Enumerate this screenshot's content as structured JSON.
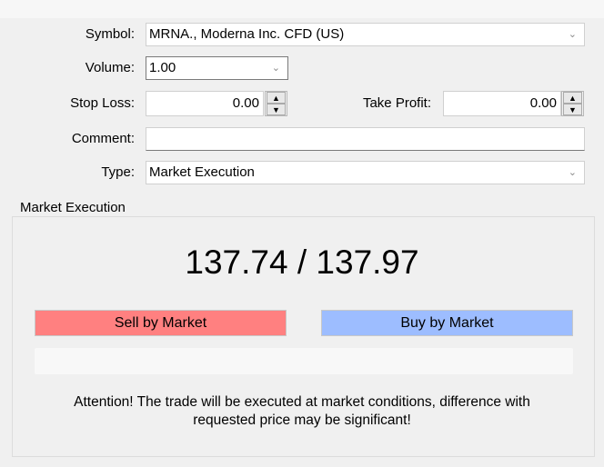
{
  "form": {
    "symbol_label": "Symbol:",
    "symbol_value": "MRNA., Moderna Inc. CFD (US)",
    "volume_label": "Volume:",
    "volume_value": "1.00",
    "stop_loss_label": "Stop Loss:",
    "stop_loss_value": "0.00",
    "take_profit_label": "Take Profit:",
    "take_profit_value": "0.00",
    "comment_label": "Comment:",
    "comment_value": "",
    "type_label": "Type:",
    "type_value": "Market Execution"
  },
  "market": {
    "group_title": "Market Execution",
    "price": "137.74 / 137.97",
    "sell_label": "Sell by Market",
    "buy_label": "Buy by Market",
    "sell_color": "#ff8080",
    "buy_color": "#9dbdff",
    "attention_line1": "Attention! The trade will be executed at market conditions, difference with",
    "attention_line2": "requested price may be significant!"
  },
  "icons": {
    "dropdown": "chevron-down-icon",
    "spin_up": "arrow-up-icon",
    "spin_down": "arrow-down-icon"
  }
}
